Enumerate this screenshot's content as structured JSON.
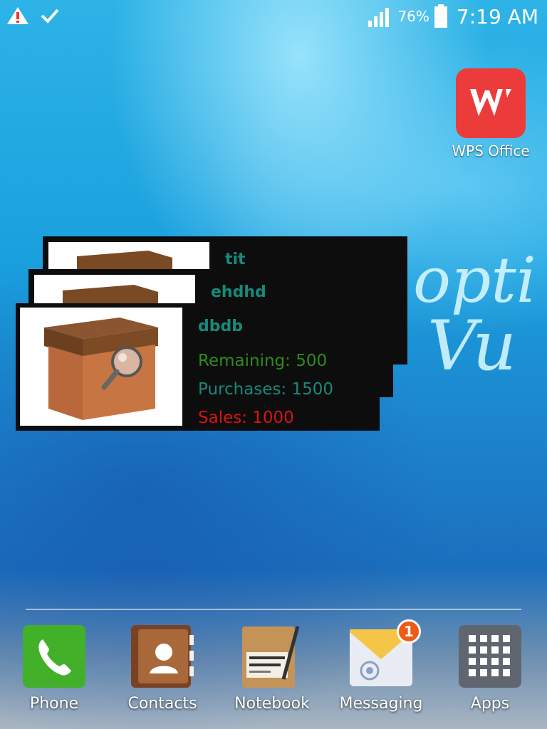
{
  "status_bar": {
    "left_icons": [
      "warning-icon",
      "check-icon"
    ],
    "battery_percent": "76%",
    "time": "7:19 AM"
  },
  "desktop": {
    "wps": {
      "label": "WPS Office",
      "color": "#ec3b3b"
    },
    "wallpaper_text": [
      "opti",
      "Vu"
    ]
  },
  "widget": {
    "cards": [
      {
        "title": "tit"
      },
      {
        "title": "ehdhd"
      },
      {
        "title": "dbdb",
        "remaining": "Remaining: 500",
        "purchases": "Purchases: 1500",
        "sales": "Sales: 1000"
      }
    ],
    "colors": {
      "title": "#178a7a",
      "remaining": "#2e8b1f",
      "purchases": "#178a7a",
      "sales": "#d71414"
    }
  },
  "dock": {
    "phone": "Phone",
    "contacts": "Contacts",
    "notebook": "Notebook",
    "messaging": "Messaging",
    "messaging_badge": "1",
    "apps": "Apps"
  }
}
